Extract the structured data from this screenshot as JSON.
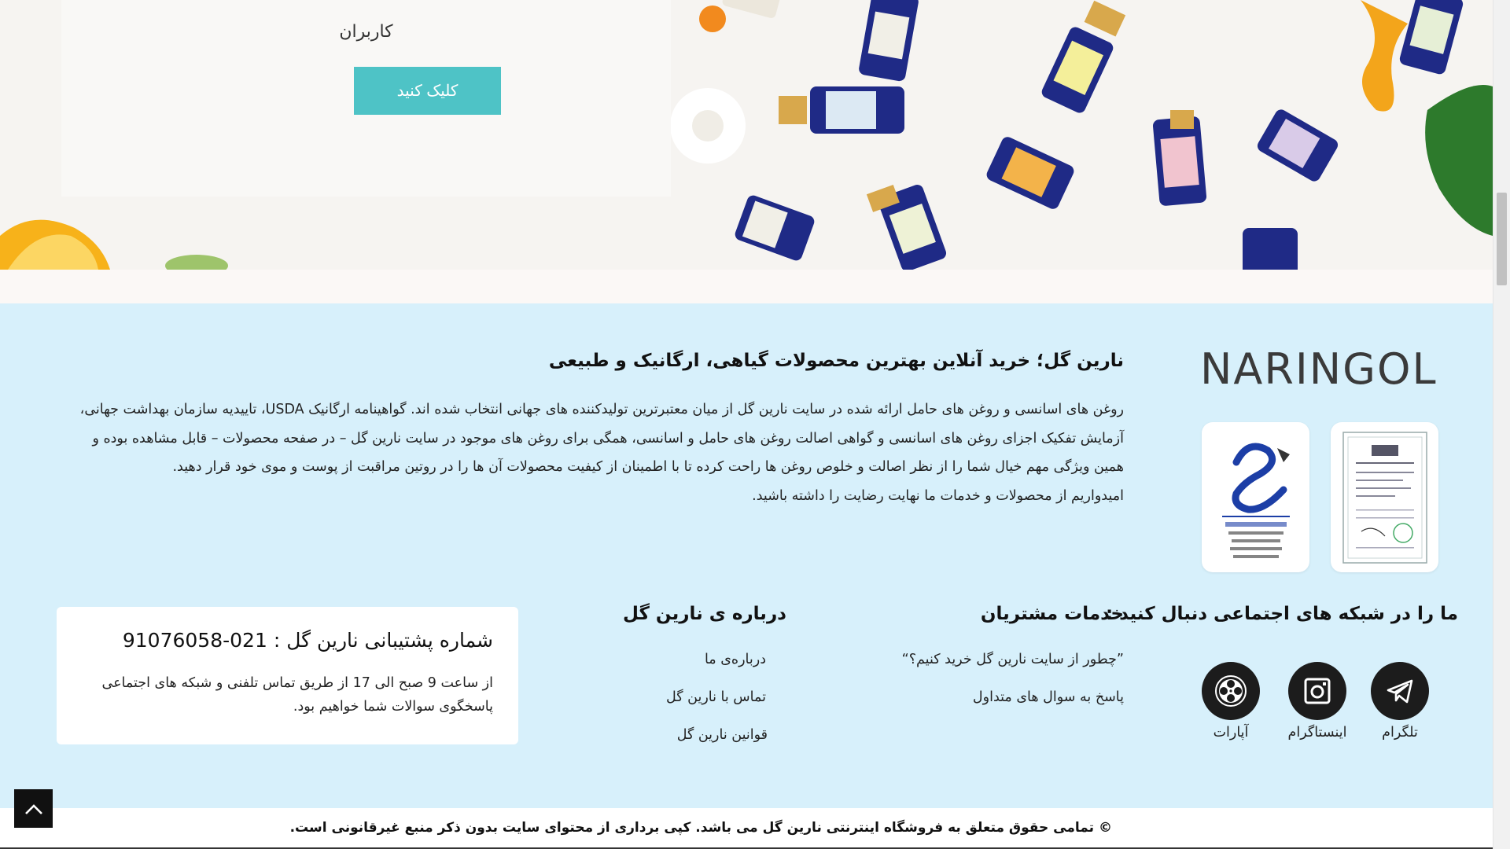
{
  "hero": {
    "text_line": "کاربران",
    "button_label": "کلیک کنید"
  },
  "logo": {
    "text": "NARINGOL"
  },
  "about": {
    "title": "نارین گل؛ خرید آنلاین بهترین محصولات گیاهی، ارگانیک و طبیعی",
    "lines": [
      "روغن های اسانسی و روغن های حامل ارائه شده در سایت نارین گل از میان معتبرترین تولیدکننده های جهانی انتخاب شده اند. گواهینامه ارگانیک USDA، تاییدیه سازمان بهداشت جهانی،",
      "آزمایش تفکیک اجزای روغن های اسانسی و گواهی اصالت روغن های حامل و اسانسی، همگی برای روغن های موجود در سایت نارین گل – در صفحه محصولات – قابل مشاهده بوده و",
      "همین ویژگی مهم خیال شما را از نظر اصالت و خلوص روغن ها راحت کرده تا با اطمینان از کیفیت محصولات آن ها را در روتین مراقبت از پوست و موی خود قرار دهید.",
      "امیدواریم از محصولات و خدمات ما نهایت رضایت را داشته باشید."
    ]
  },
  "social": {
    "title": "ما را در شبکه های اجتماعی دنبال کنید :",
    "items": [
      {
        "label": "تلگرام",
        "icon": "telegram-icon"
      },
      {
        "label": "اینستاگرام",
        "icon": "instagram-icon"
      },
      {
        "label": "آپارات",
        "icon": "aparat-icon"
      }
    ]
  },
  "services": {
    "title": "خدمات مشتریان",
    "links": [
      "”چطور از سایت نارین گل خرید کنیم؟“",
      "پاسخ به سوال های متداول"
    ]
  },
  "aboutus": {
    "title": "درباره ی نارین گل",
    "links": [
      "درباره‌ی ما",
      "تماس با نارین گل",
      "قوانین نارین گل"
    ]
  },
  "support": {
    "title": "شماره پشتیبانی نارین گل : 021-91076058",
    "lines": [
      "از ساعت 9 صبح الی 17 از طریق تماس تلفنی و  شبکه های اجتماعی",
      "پاسخگوی سوالات شما خواهیم بود."
    ]
  },
  "copyright": "© تمامی حقوق متعلق به فروشگاه اینترنتی نارین گل می باشد. کپی برداری از محتوای سایت بدون ذکر منبع غیرقانونی است.",
  "colors": {
    "accent_button": "#4ec3c6",
    "footer_bg": "#d7f0fb",
    "social_circle": "#1c1c1c"
  }
}
